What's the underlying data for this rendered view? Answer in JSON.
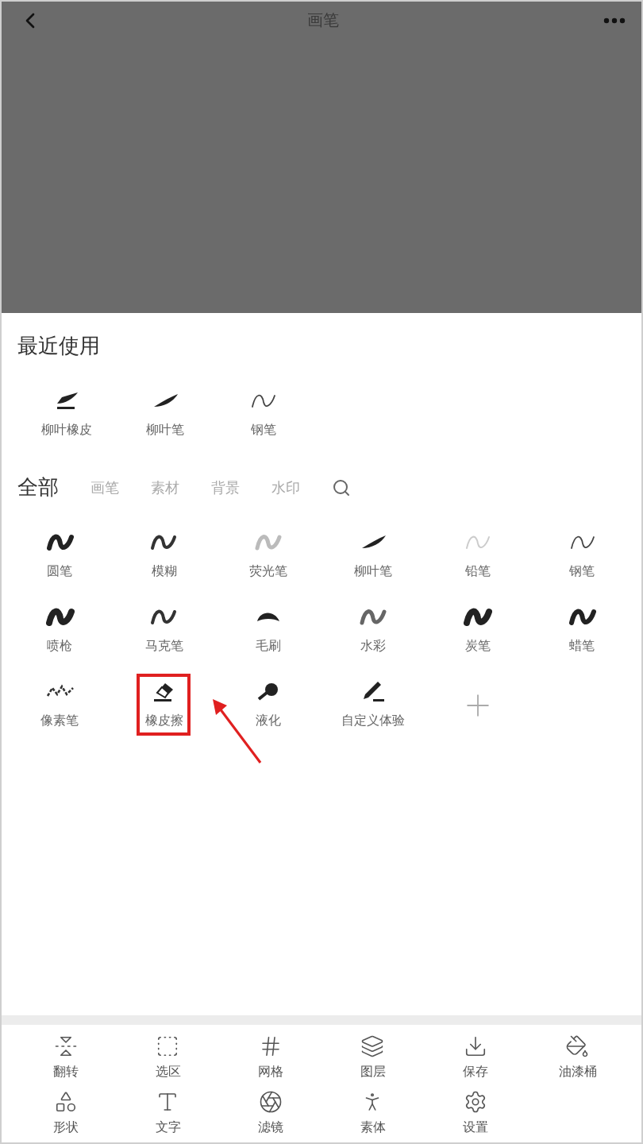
{
  "header": {
    "title": "画笔"
  },
  "recent": {
    "title": "最近使用",
    "items": [
      {
        "label": "柳叶橡皮",
        "kind": "leaf-eraser"
      },
      {
        "label": "柳叶笔",
        "kind": "leaf"
      },
      {
        "label": "钢笔",
        "kind": "thin"
      }
    ]
  },
  "tabs": [
    {
      "label": "全部",
      "selected": true
    },
    {
      "label": "画笔",
      "selected": false
    },
    {
      "label": "素材",
      "selected": false
    },
    {
      "label": "背景",
      "selected": false
    },
    {
      "label": "水印",
      "selected": false
    }
  ],
  "brushes": [
    {
      "label": "圆笔",
      "kind": "bold",
      "highlighted": false
    },
    {
      "label": "模糊",
      "kind": "medium",
      "highlighted": false
    },
    {
      "label": "荧光笔",
      "kind": "faint",
      "highlighted": false
    },
    {
      "label": "柳叶笔",
      "kind": "leaf",
      "highlighted": false
    },
    {
      "label": "铅笔",
      "kind": "pencil",
      "highlighted": false
    },
    {
      "label": "钢笔",
      "kind": "thin",
      "highlighted": false
    },
    {
      "label": "喷枪",
      "kind": "heavy",
      "highlighted": false
    },
    {
      "label": "马克笔",
      "kind": "medium",
      "highlighted": false
    },
    {
      "label": "毛刷",
      "kind": "blob",
      "highlighted": false
    },
    {
      "label": "水彩",
      "kind": "watercolor",
      "highlighted": false
    },
    {
      "label": "炭笔",
      "kind": "heavy",
      "highlighted": false
    },
    {
      "label": "蜡笔",
      "kind": "bold",
      "highlighted": false
    },
    {
      "label": "像素笔",
      "kind": "pixel",
      "highlighted": false
    },
    {
      "label": "橡皮擦",
      "kind": "eraser",
      "highlighted": true
    },
    {
      "label": "液化",
      "kind": "liquify",
      "highlighted": false
    },
    {
      "label": "自定义体验",
      "kind": "custom",
      "highlighted": false
    }
  ],
  "toolbar": [
    {
      "label": "翻转",
      "kind": "flip"
    },
    {
      "label": "选区",
      "kind": "select"
    },
    {
      "label": "网格",
      "kind": "grid"
    },
    {
      "label": "图层",
      "kind": "layers"
    },
    {
      "label": "保存",
      "kind": "save"
    },
    {
      "label": "油漆桶",
      "kind": "bucket"
    },
    {
      "label": "形状",
      "kind": "shapes"
    },
    {
      "label": "文字",
      "kind": "text"
    },
    {
      "label": "滤镜",
      "kind": "filter"
    },
    {
      "label": "素体",
      "kind": "figure"
    },
    {
      "label": "设置",
      "kind": "settings"
    }
  ]
}
